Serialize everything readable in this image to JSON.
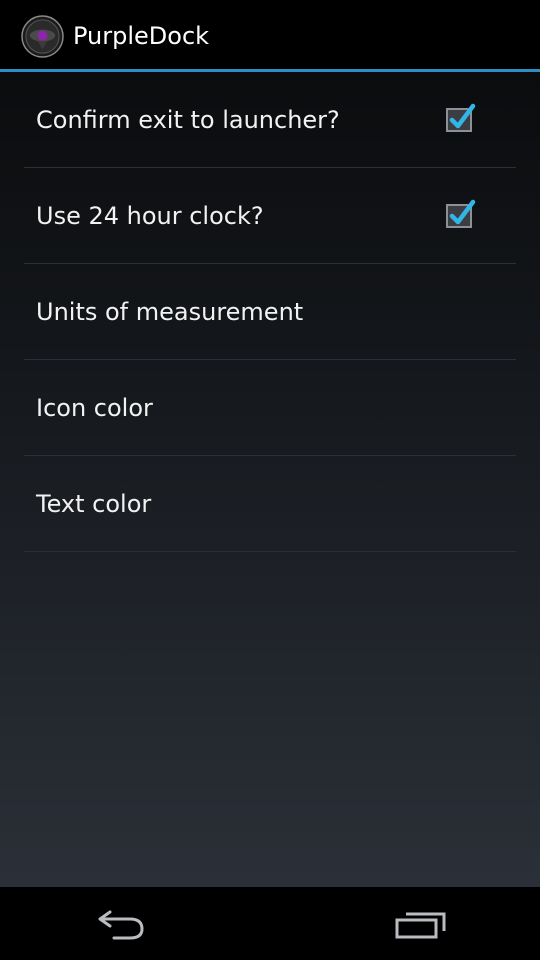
{
  "app": {
    "title": "PurpleDock",
    "icon": "purpledock-app-icon"
  },
  "colors": {
    "accent": "#2f8fc3",
    "checkmark": "#33b5e5",
    "icon_purple": "#8e24aa"
  },
  "preferences": [
    {
      "label": "Confirm exit to launcher?",
      "type": "checkbox",
      "checked": true
    },
    {
      "label": "Use 24 hour clock?",
      "type": "checkbox",
      "checked": true
    },
    {
      "label": "Units of measurement",
      "type": "link"
    },
    {
      "label": "Icon color",
      "type": "link"
    },
    {
      "label": "Text color",
      "type": "link"
    }
  ],
  "navigation": {
    "back_icon": "back-arrow-icon",
    "recents_icon": "recent-apps-icon"
  }
}
